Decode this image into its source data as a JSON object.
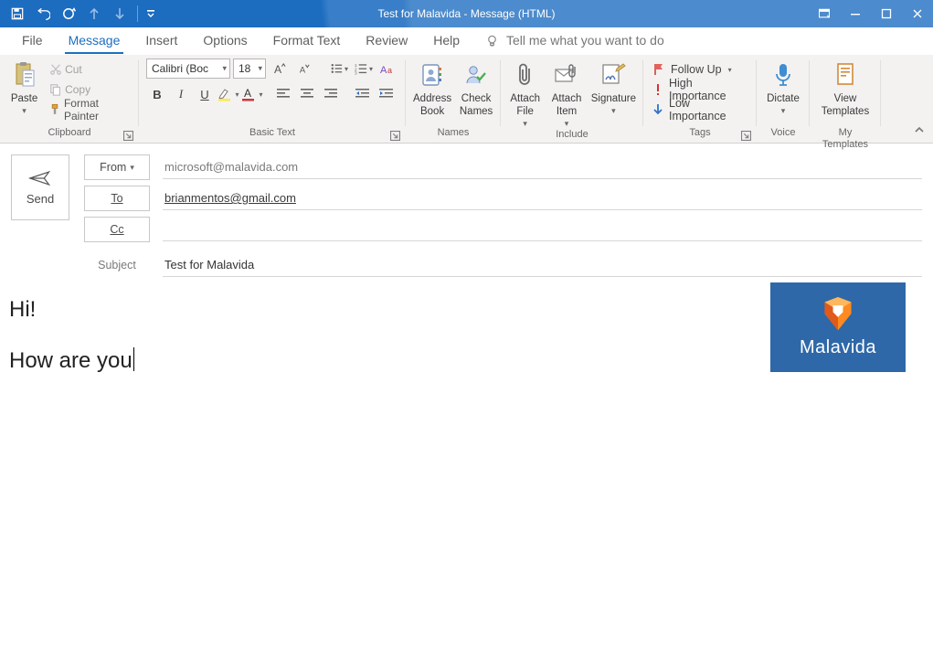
{
  "window": {
    "title": "Test for Malavida  -  Message (HTML)"
  },
  "qat": {
    "save": "save-icon",
    "undo": "undo-icon",
    "redo": "redo-icon",
    "prev": "up-arrow-icon",
    "next": "down-arrow-icon"
  },
  "tabs": [
    "File",
    "Message",
    "Insert",
    "Options",
    "Format Text",
    "Review",
    "Help"
  ],
  "active_tab": "Message",
  "tell_me_placeholder": "Tell me what you want to do",
  "ribbon": {
    "clipboard": {
      "paste": "Paste",
      "cut": "Cut",
      "copy": "Copy",
      "format_painter": "Format Painter",
      "title": "Clipboard"
    },
    "basic_text": {
      "font_name": "Calibri (Boc",
      "font_size": "18",
      "title": "Basic Text"
    },
    "names": {
      "address_book": "Address\nBook",
      "check_names": "Check\nNames",
      "title": "Names"
    },
    "include": {
      "attach_file": "Attach\nFile",
      "attach_item": "Attach\nItem",
      "signature": "Signature",
      "title": "Include"
    },
    "tags": {
      "follow_up": "Follow Up",
      "high_importance": "High Importance",
      "low_importance": "Low Importance",
      "title": "Tags"
    },
    "voice": {
      "dictate": "Dictate",
      "title": "Voice"
    },
    "my_templates": {
      "view_templates": "View\nTemplates",
      "title": "My Templates"
    }
  },
  "header": {
    "from_btn": "From",
    "from_value": "microsoft@malavida.com",
    "to_btn": "To",
    "to_value": "brianmentos@gmail.com",
    "cc_btn": "Cc",
    "cc_value": "",
    "subject_label": "Subject",
    "subject_value": "Test for Malavida",
    "send": "Send"
  },
  "body": {
    "line1": "Hi!",
    "line2": "How are you"
  },
  "signature": {
    "brand": "Malavida"
  }
}
